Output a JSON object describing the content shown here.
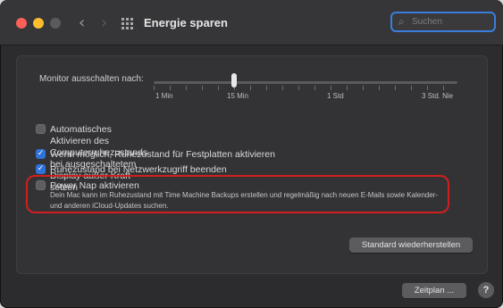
{
  "window": {
    "title": "Energie sparen",
    "search_placeholder": "Suchen"
  },
  "display_sleep": {
    "label": "Monitor ausschalten nach:",
    "ticks": [
      "1 Min",
      "15 Min",
      "1 Std",
      "3 Std. Nie"
    ]
  },
  "options": [
    {
      "label": "Automatisches Aktivieren des Computerruhezustands bei ausgeschaltetem\nDisplay außer Kraft setzen",
      "checked": false
    },
    {
      "label": "Wenn möglich, Ruhezustand für Festplatten aktivieren",
      "checked": true
    },
    {
      "label": "Ruhezustand bei Netzwerkzugriff beenden",
      "checked": true
    },
    {
      "label": "Power Nap aktivieren",
      "checked": false
    }
  ],
  "power_nap_description": "Dein Mac kann im Ruhezustand mit Time Machine Backups erstellen und regelmäßig nach neuen E-Mails sowie Kalender- und anderen iCloud-Updates suchen.",
  "buttons": {
    "restore": "Standard wiederherstellen",
    "schedule": "Zeitplan ...",
    "help": "?"
  },
  "colors": {
    "accent": "#3b7ddd",
    "highlight": "#d11f1f"
  }
}
